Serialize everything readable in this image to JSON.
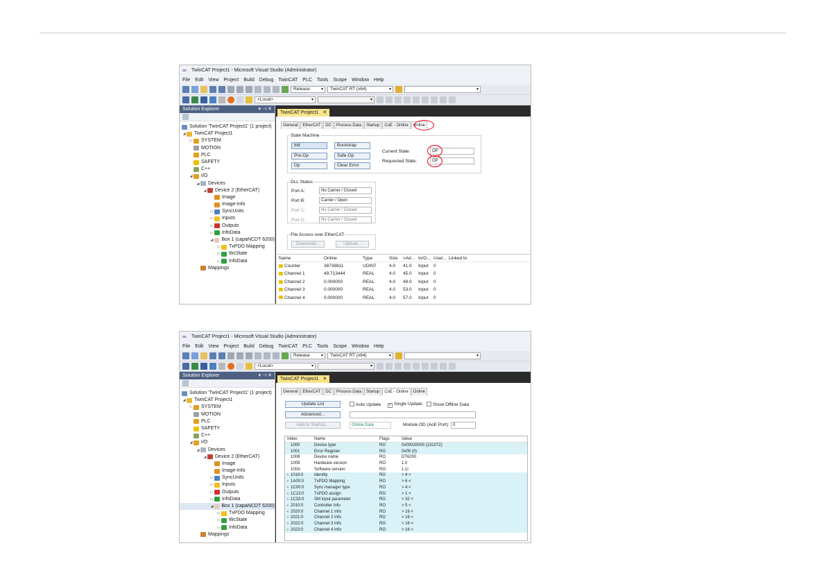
{
  "window": {
    "title": "TwinCAT Project1 - Microsoft Visual Studio (Administrator)"
  },
  "menu": [
    "File",
    "Edit",
    "View",
    "Project",
    "Build",
    "Debug",
    "TwinCAT",
    "PLC",
    "Tools",
    "Scope",
    "Window",
    "Help"
  ],
  "toolbar": {
    "config": "Release",
    "platform": "TwinCAT RT (x64)",
    "target": "<Local>"
  },
  "solution_explorer": {
    "title": "Solution Explorer",
    "pin": "▾ ⊣ ✕",
    "tree": [
      "Solution 'TwinCAT Project1' (1 project)",
      "TwinCAT Project1",
      "SYSTEM",
      "MOTION",
      "PLC",
      "SAFETY",
      "C++",
      "I/O",
      "Devices",
      "Device 2 (EtherCAT)",
      "Image",
      "Image-Info",
      "SyncUnits",
      "Inputs",
      "Outputs",
      "InfoData",
      "Box 1 (capaNCDT 6200)",
      "TxPDO Mapping",
      "WcState",
      "InfoData",
      "Mappings"
    ]
  },
  "doc_tab": {
    "label": "TwinCAT Project1",
    "close": "✕"
  },
  "tabs": [
    "General",
    "EtherCAT",
    "DC",
    "Process Data",
    "Startup",
    "CoE - Online",
    "Online"
  ],
  "online": {
    "state_machine": "State Machine",
    "buttons": [
      "Init",
      "Bootstrap",
      "Pre-Op",
      "Safe-Op",
      "Op",
      "Clear Error"
    ],
    "current_state_label": "Current State:",
    "current_state": "OP",
    "requested_state_label": "Requested State:",
    "requested_state": "OP",
    "dll_status": "DLL Status",
    "ports": [
      {
        "label": "Port A:",
        "value": "No Carrier / Closed"
      },
      {
        "label": "Port B:",
        "value": "Carrier / Open"
      },
      {
        "label": "Port C:",
        "value": "No Carrier / Closed"
      },
      {
        "label": "Port D:",
        "value": "No Carrier / Closed"
      }
    ],
    "file_access": "File Access over EtherCAT",
    "download": "Download...",
    "upload": "Upload...",
    "columns": [
      "Name",
      "Online",
      "Type",
      "Size",
      ">Ad...",
      "In/O...",
      "User...",
      "Linked to"
    ],
    "rows": [
      [
        "Counter",
        "38738611",
        "UDINT",
        "4.0",
        "41.0",
        "Input",
        "0"
      ],
      [
        "Channel 1",
        "49.713444",
        "REAL",
        "4.0",
        "45.0",
        "Input",
        "0"
      ],
      [
        "Channel 2",
        "0.000000",
        "REAL",
        "4.0",
        "49.0",
        "Input",
        "0"
      ],
      [
        "Channel 3",
        "0.000000",
        "REAL",
        "4.0",
        "53.0",
        "Input",
        "0"
      ],
      [
        "Channel 4",
        "0.000000",
        "REAL",
        "4.0",
        "57.0",
        "Input",
        "0"
      ]
    ]
  },
  "coe": {
    "update_list": "Update List",
    "auto_update": "Auto Update",
    "single_update": "Single Update",
    "show_offline": "Show Offline Data",
    "advanced": "Advanced...",
    "add_startup": "Add to Startup...",
    "online_data": "Online Data",
    "module_od_label": "Module OD (AoE Port):",
    "module_od": "0",
    "columns": [
      "Index",
      "Name",
      "Flags",
      "Value"
    ],
    "rows": [
      [
        "",
        "1000",
        "Device type",
        "RO",
        "0x00020000 (131072)"
      ],
      [
        "",
        "1001",
        "Error Register",
        "RO",
        "0x09 (0)"
      ],
      [
        "",
        "1008",
        "Device name",
        "RO",
        "DT6200"
      ],
      [
        "",
        "1009",
        "Hardware version",
        "RO",
        "1.0"
      ],
      [
        "",
        "100A",
        "Software version",
        "RO",
        "1.1i"
      ],
      [
        "+",
        "1018:0",
        "Identity",
        "RO",
        "> 4 <"
      ],
      [
        "+",
        "1A00:0",
        "TxPDO Mapping",
        "RO",
        "> 6 <"
      ],
      [
        "+",
        "1C00:0",
        "Sync manager type",
        "RO",
        "> 4 <"
      ],
      [
        "+",
        "1C13:0",
        "TxPDO assign",
        "RO",
        "> 1 <"
      ],
      [
        "+",
        "1C33:0",
        "SM input parameter",
        "RO",
        "> 32 <"
      ],
      [
        "+",
        "2010:0",
        "Controller Info",
        "RO",
        "> 5 <"
      ],
      [
        "+",
        "2020:0",
        "Channel 1 Info",
        "RO",
        "> 16 <"
      ],
      [
        "+",
        "2021:0",
        "Channel 2 Info",
        "RO",
        "> 16 <"
      ],
      [
        "+",
        "2022:0",
        "Channel 3 Info",
        "RO",
        "> 16 <"
      ],
      [
        "+",
        "2023:0",
        "Channel 4 Info",
        "RO",
        "> 16 <"
      ]
    ]
  }
}
